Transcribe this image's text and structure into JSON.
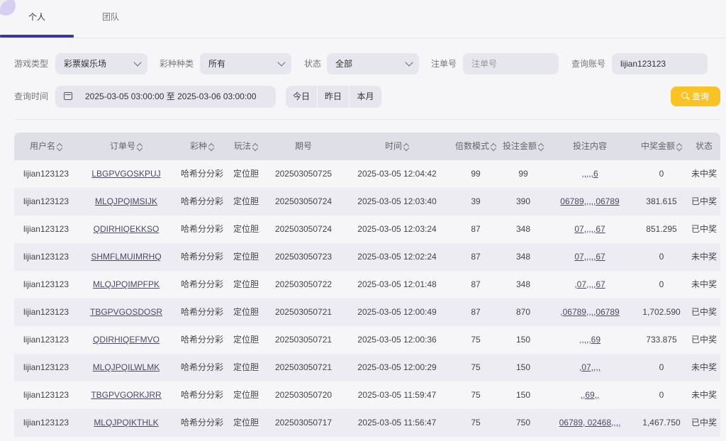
{
  "tabs": [
    {
      "label": "个人",
      "active": true
    },
    {
      "label": "团队",
      "active": false
    }
  ],
  "filters": {
    "game_type_label": "游戏类型",
    "game_type_value": "彩票娱乐场",
    "lottery_kind_label": "彩种种类",
    "lottery_kind_value": "所有",
    "status_label": "状态",
    "status_value": "全部",
    "order_no_label": "注单号",
    "order_no_placeholder": "注单号",
    "account_label": "查询账号",
    "account_value": "lijian123123",
    "time_label": "查询时间",
    "time_range": "2025-03-05 03:00:00 至 2025-03-06 03:00:00",
    "quick_today": "今日",
    "quick_yesterday": "昨日",
    "quick_month": "本月",
    "search_label": "查询"
  },
  "table": {
    "headers": [
      "用户名",
      "订单号",
      "彩种",
      "玩法",
      "期号",
      "时间",
      "倍数模式",
      "投注金额",
      "投注内容",
      "中奖金额",
      "状态"
    ],
    "rows": [
      [
        "lijian123123",
        "LBGPVGOSKPUJ",
        "哈希分分彩",
        "定位胆",
        "202503050725",
        "2025-03-05 12:04:42",
        "99",
        "99",
        ",,,,,6",
        "0",
        "未中奖"
      ],
      [
        "lijian123123",
        "MLQJPQIMSIJK",
        "哈希分分彩",
        "定位胆",
        "202503050724",
        "2025-03-05 12:03:40",
        "39",
        "390",
        "06789,,,,,06789",
        "381.615",
        "已中奖"
      ],
      [
        "lijian123123",
        "QDIRHIQEKKSO",
        "哈希分分彩",
        "定位胆",
        "202503050724",
        "2025-03-05 12:03:24",
        "87",
        "348",
        "07,,,,,67",
        "851.295",
        "已中奖"
      ],
      [
        "lijian123123",
        "SHMFLMUIMRHQ",
        "哈希分分彩",
        "定位胆",
        "202503050723",
        "2025-03-05 12:02:24",
        "87",
        "348",
        "07,,,,,67",
        "0",
        "未中奖"
      ],
      [
        "lijian123123",
        "MLQJPQIMPFPK",
        "哈希分分彩",
        "定位胆",
        "202503050722",
        "2025-03-05 12:01:48",
        "87",
        "348",
        ",07,,,,67",
        "0",
        "未中奖"
      ],
      [
        "lijian123123",
        "TBGPVGOSDOSR",
        "哈希分分彩",
        "定位胆",
        "202503050721",
        "2025-03-05 12:00:49",
        "87",
        "870",
        ",06789,,,,06789",
        "1,702.590",
        "已中奖"
      ],
      [
        "lijian123123",
        "QDIRHIQEFMVO",
        "哈希分分彩",
        "定位胆",
        "202503050721",
        "2025-03-05 12:00:36",
        "75",
        "150",
        ",,,,,69",
        "733.875",
        "已中奖"
      ],
      [
        "lijian123123",
        "MLQJPQILWLMK",
        "哈希分分彩",
        "定位胆",
        "202503050721",
        "2025-03-05 12:00:29",
        "75",
        "150",
        ",07,,,,",
        "0",
        "未中奖"
      ],
      [
        "lijian123123",
        "TBGPVGORKJRR",
        "哈希分分彩",
        "定位胆",
        "202503050720",
        "2025-03-05 11:59:47",
        "75",
        "150",
        ",,69,,",
        "0",
        "未中奖"
      ],
      [
        "lijian123123",
        "MLQJPQIKTHLK",
        "哈希分分彩",
        "定位胆",
        "202503050717",
        "2025-03-05 11:56:47",
        "75",
        "750",
        "06789, 02468,,,,",
        "1,467.750",
        "已中奖"
      ]
    ]
  },
  "colors": {
    "accent": "#3d3a96",
    "search_button": "#f9c226"
  }
}
